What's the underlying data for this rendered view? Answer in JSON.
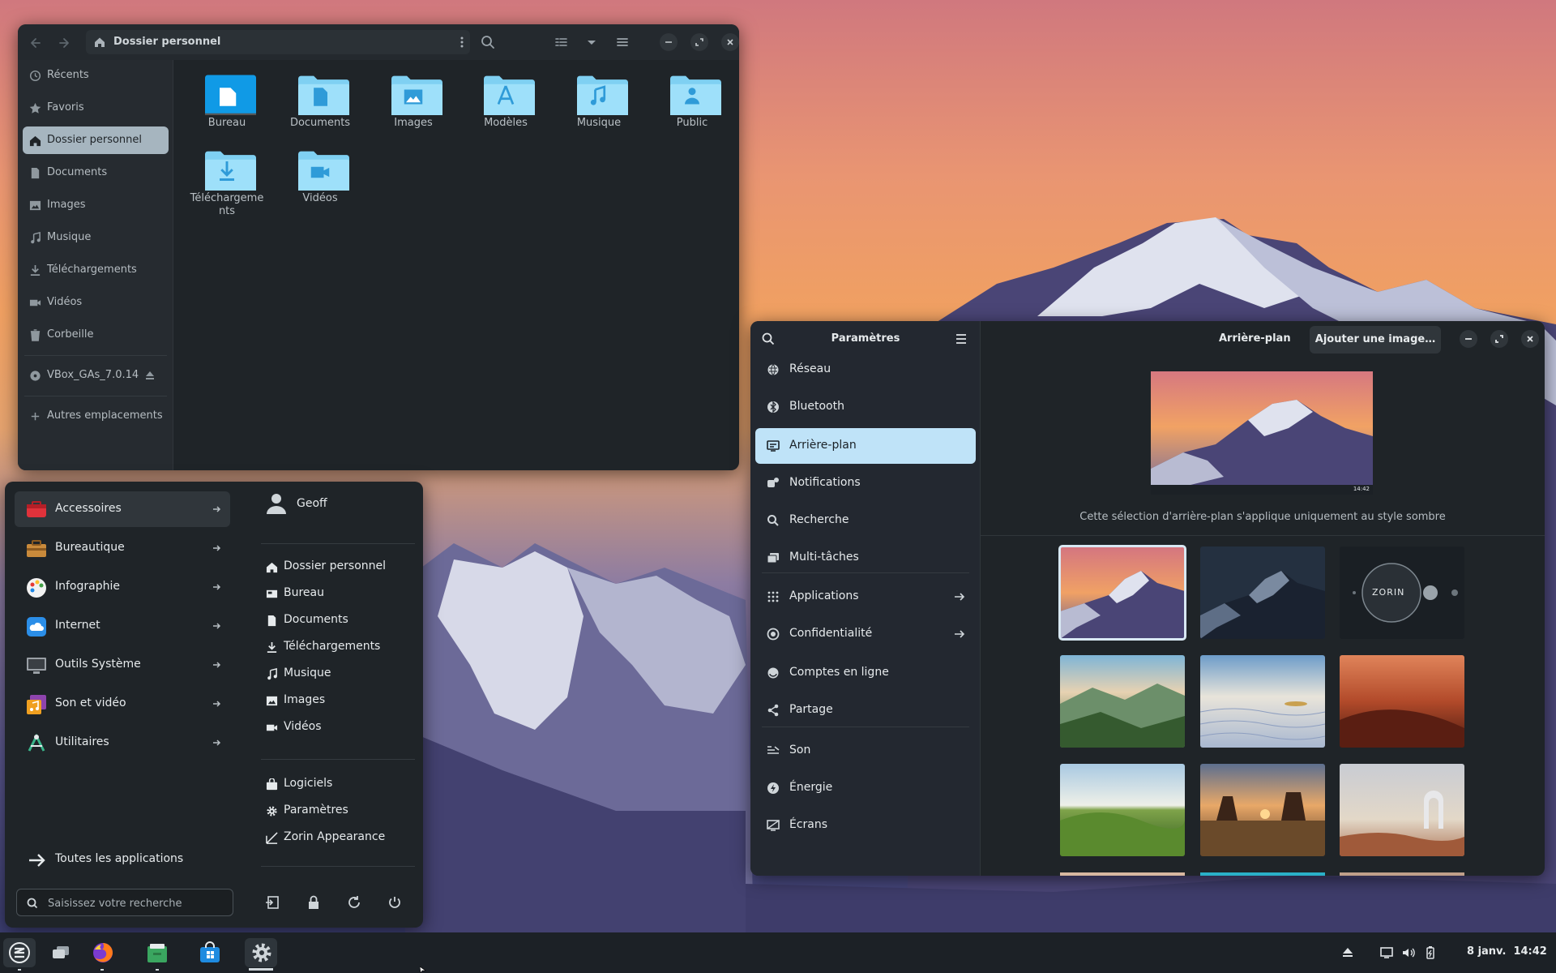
{
  "file_manager": {
    "path_title": "Dossier personnel",
    "sidebar": [
      {
        "label": "Récents",
        "icon": "clock-icon"
      },
      {
        "label": "Favoris",
        "icon": "star-icon"
      },
      {
        "label": "Dossier personnel",
        "icon": "home-icon",
        "selected": true
      },
      {
        "label": "Documents",
        "icon": "document-icon"
      },
      {
        "label": "Images",
        "icon": "image-icon"
      },
      {
        "label": "Musique",
        "icon": "music-icon"
      },
      {
        "label": "Téléchargements",
        "icon": "download-icon"
      },
      {
        "label": "Vidéos",
        "icon": "video-icon"
      },
      {
        "label": "Corbeille",
        "icon": "trash-icon"
      },
      {
        "label": "VBox_GAs_7.0.14",
        "icon": "disc-icon"
      },
      {
        "label": "Autres emplacements",
        "icon": "plus-icon"
      }
    ],
    "folders": [
      {
        "label": "Bureau",
        "icon": "desktop-folder-icon"
      },
      {
        "label": "Documents",
        "icon": "documents-folder-icon"
      },
      {
        "label": "Images",
        "icon": "pictures-folder-icon"
      },
      {
        "label": "Modèles",
        "icon": "templates-folder-icon"
      },
      {
        "label": "Musique",
        "icon": "music-folder-icon"
      },
      {
        "label": "Public",
        "icon": "public-folder-icon"
      },
      {
        "label": "Téléchargements",
        "icon": "downloads-folder-icon"
      },
      {
        "label": "Vidéos",
        "icon": "videos-folder-icon"
      }
    ]
  },
  "app_menu": {
    "categories": [
      {
        "label": "Accessoires",
        "selected": true
      },
      {
        "label": "Bureautique"
      },
      {
        "label": "Infographie"
      },
      {
        "label": "Internet"
      },
      {
        "label": "Outils Système"
      },
      {
        "label": "Son et vidéo"
      },
      {
        "label": "Utilitaires"
      }
    ],
    "all_apps_label": "Toutes les applications",
    "search_placeholder": "Saisissez votre recherche",
    "user_name": "Geoff",
    "places": [
      {
        "label": "Dossier personnel",
        "icon": "home-icon"
      },
      {
        "label": "Bureau",
        "icon": "desktop-icon"
      },
      {
        "label": "Documents",
        "icon": "document-icon"
      },
      {
        "label": "Téléchargements",
        "icon": "download-icon"
      },
      {
        "label": "Musique",
        "icon": "music-icon"
      },
      {
        "label": "Images",
        "icon": "image-icon"
      },
      {
        "label": "Vidéos",
        "icon": "video-icon"
      }
    ],
    "system": [
      {
        "label": "Logiciels",
        "icon": "software-icon"
      },
      {
        "label": "Paramètres",
        "icon": "gear-icon"
      },
      {
        "label": "Zorin Appearance",
        "icon": "appearance-icon"
      }
    ]
  },
  "settings": {
    "sidebar_title": "Paramètres",
    "page_title": "Arrière-plan",
    "add_image_label": "Ajouter une image…",
    "caption": "Cette sélection d'arrière-plan s'applique uniquement au style sombre",
    "preview_time": "14:42",
    "zorin_text": "ZORIN",
    "items": [
      {
        "label": "Réseau",
        "icon": "network-icon"
      },
      {
        "label": "Bluetooth",
        "icon": "bluetooth-icon"
      },
      {
        "label": "Arrière-plan",
        "icon": "background-icon",
        "selected": true
      },
      {
        "label": "Notifications",
        "icon": "notifications-icon"
      },
      {
        "label": "Recherche",
        "icon": "search-icon"
      },
      {
        "label": "Multi-tâches",
        "icon": "multitasking-icon"
      },
      {
        "label": "Applications",
        "icon": "apps-icon",
        "arrow": true
      },
      {
        "label": "Confidentialité",
        "icon": "privacy-icon",
        "arrow": true
      },
      {
        "label": "Comptes en ligne",
        "icon": "accounts-icon"
      },
      {
        "label": "Partage",
        "icon": "share-icon"
      },
      {
        "label": "Son",
        "icon": "sound-icon"
      },
      {
        "label": "Énergie",
        "icon": "power-icon"
      },
      {
        "label": "Écrans",
        "icon": "displays-icon"
      }
    ]
  },
  "taskbar": {
    "clock": "8 janv.  14:42"
  },
  "colors": {
    "accent": "#bfe3f8",
    "folder": "#7fd0f2",
    "panel": "#1f2428"
  }
}
